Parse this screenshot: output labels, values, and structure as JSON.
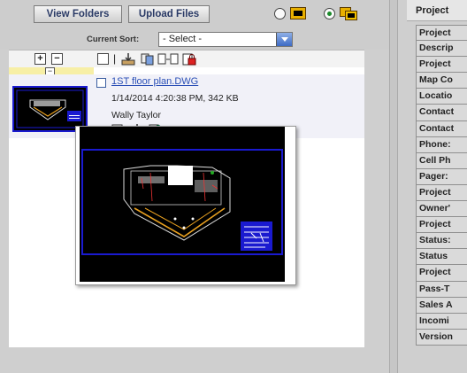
{
  "toolbar": {
    "view_folders_label": "View Folders",
    "upload_files_label": "Upload Files",
    "view_modes": [
      "thumbnail-view",
      "list-view"
    ],
    "selected_view": "list-view"
  },
  "sort": {
    "label": "Current Sort:",
    "selected": "- Select -"
  },
  "list_header": {
    "expand_label": "+",
    "collapse_label": "−",
    "separator": "|"
  },
  "group": {
    "collapse_label": "−"
  },
  "file_item": {
    "name": "1ST floor plan.DWG",
    "meta": "1/14/2014 4:20:38 PM, 342 KB",
    "owner": "Wally Taylor"
  },
  "right_panel": {
    "header": "Project",
    "fields": [
      "Project",
      "Descrip",
      "Project",
      "Map Co",
      "Locatio",
      "Contact",
      "Contact",
      "Phone:",
      "Cell Ph",
      "Pager:",
      "Project",
      "Owner'",
      "Project",
      "Status:",
      "Status",
      "Project",
      "Pass-T",
      "Sales A",
      "Incomi",
      "Version"
    ]
  },
  "colors": {
    "link": "#2a4fb6",
    "drawing_border": "#1a1ad0",
    "drawing_bg": "#000000",
    "radio_selected": "#1a8a2a"
  }
}
